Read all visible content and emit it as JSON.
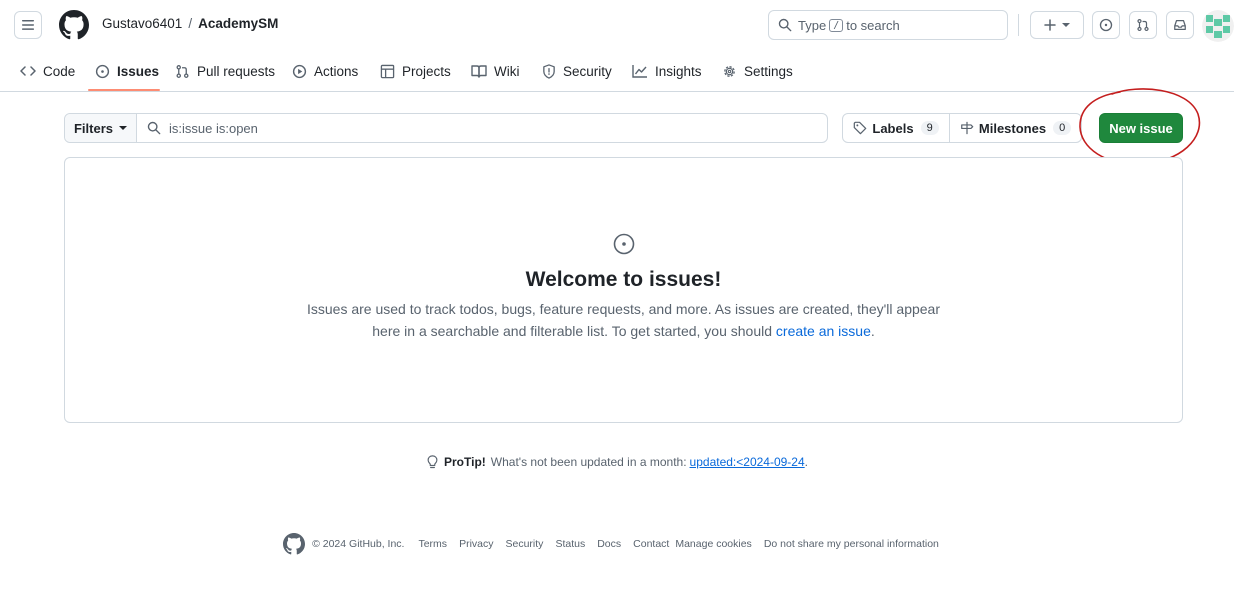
{
  "header": {
    "owner": "Gustavo6401",
    "separator": "/",
    "repo": "AcademySM",
    "search_prefix": "Type",
    "search_key": "/",
    "search_suffix": "to search"
  },
  "tabs": [
    {
      "label": "Code"
    },
    {
      "label": "Issues"
    },
    {
      "label": "Pull requests"
    },
    {
      "label": "Actions"
    },
    {
      "label": "Projects"
    },
    {
      "label": "Wiki"
    },
    {
      "label": "Security"
    },
    {
      "label": "Insights"
    },
    {
      "label": "Settings"
    }
  ],
  "toolbar": {
    "filters_label": "Filters",
    "query": "is:issue is:open",
    "labels_label": "Labels",
    "labels_count": "9",
    "milestones_label": "Milestones",
    "milestones_count": "0",
    "new_issue_label": "New issue"
  },
  "empty_state": {
    "title": "Welcome to issues!",
    "text_before": "Issues are used to track todos, bugs, feature requests, and more. As issues are created, they'll appear here in a searchable and filterable list. To get started, you should ",
    "link": "create an issue",
    "text_after": "."
  },
  "protip": {
    "label": "ProTip!",
    "text": "What's not been updated in a month:",
    "link": "updated:<2024-09-24",
    "end": "."
  },
  "footer": {
    "copyright": "© 2024 GitHub, Inc.",
    "links": [
      "Terms",
      "Privacy",
      "Security",
      "Status",
      "Docs",
      "Contact",
      "Manage cookies",
      "Do not share my personal information"
    ]
  },
  "colors": {
    "primary_button": "#1f883d",
    "link": "#0969da",
    "active_tab_underline": "#fd8c73",
    "annotation": "#c41e1e"
  }
}
